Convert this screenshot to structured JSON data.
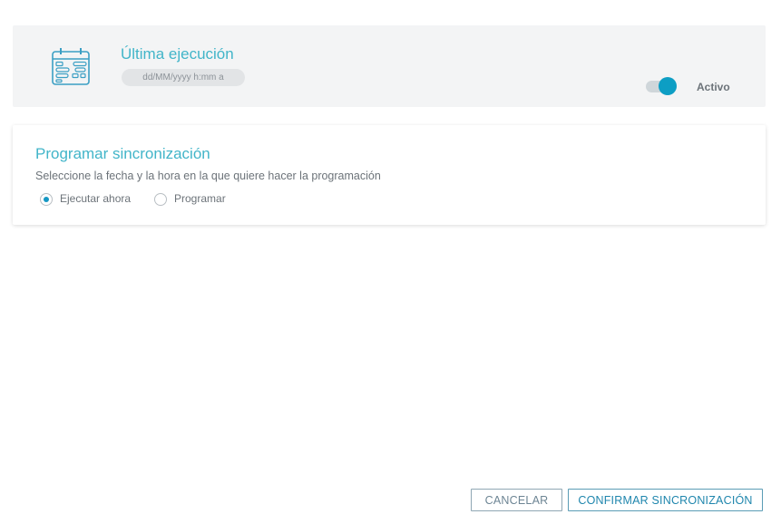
{
  "status": {
    "title": "Última ejecución",
    "date_placeholder": "dd/MM/yyyy h:mm a",
    "toggle_label": "Activo",
    "toggle_on": true
  },
  "schedule": {
    "title": "Programar sincronización",
    "description": "Seleccione la fecha y la hora en la que quiere hacer la programación",
    "options": [
      {
        "label": "Ejecutar ahora",
        "checked": true
      },
      {
        "label": "Programar",
        "checked": false
      }
    ]
  },
  "actions": {
    "cancel_label": "CANCELAR",
    "confirm_label": "CONFIRMAR SINCRONIZACIÓN"
  },
  "colors": {
    "accent": "#42b5c9",
    "toggle_on": "#0d9ec4",
    "button_text": "#1f86ad"
  },
  "icons": [
    "calendar-icon"
  ]
}
